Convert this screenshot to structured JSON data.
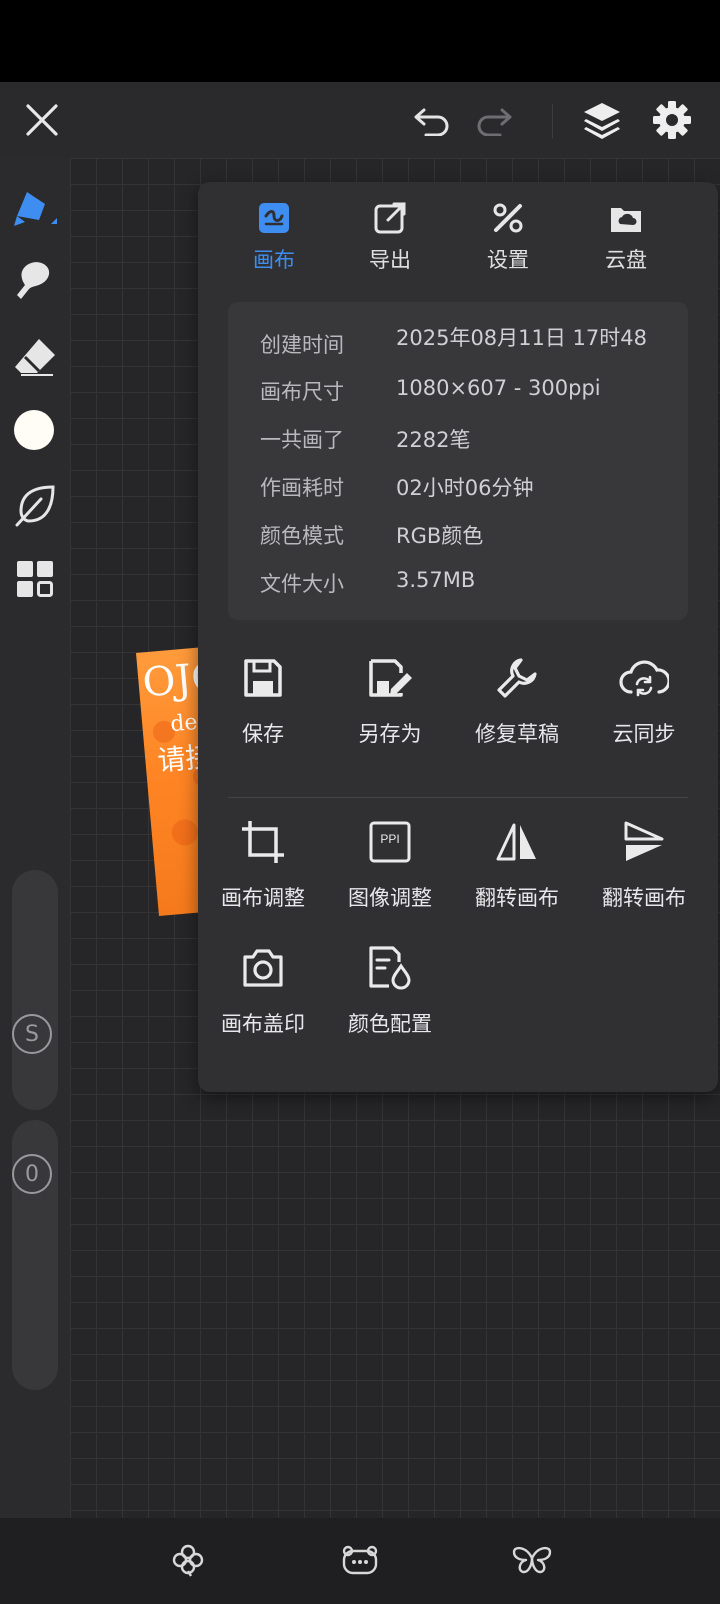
{
  "toolbar": {
    "close": "close-icon",
    "undo": "undo-icon",
    "redo": "redo-icon",
    "layers": "layers-icon",
    "settings": "gear-icon"
  },
  "tools": [
    "pen-brush-icon",
    "smudge-icon",
    "eraser-icon",
    "color-swatch",
    "leaf-icon",
    "grid-menu-icon"
  ],
  "sliders": {
    "size_label": "S",
    "opacity_label": "0"
  },
  "panel": {
    "tabs": [
      {
        "label": "画布",
        "icon": "canvas-icon",
        "active": true
      },
      {
        "label": "导出",
        "icon": "export-icon",
        "active": false
      },
      {
        "label": "设置",
        "icon": "tools-icon",
        "active": false
      },
      {
        "label": "云盘",
        "icon": "cloud-drive-icon",
        "active": false
      }
    ],
    "info": [
      {
        "key": "创建时间",
        "value": "2025年08月11日 17时48分"
      },
      {
        "key": "画布尺寸",
        "value": "1080×607 - 300ppi"
      },
      {
        "key": "一共画了",
        "value": "2282笔"
      },
      {
        "key": "作画耗时",
        "value": "02小时06分钟"
      },
      {
        "key": "颜色模式",
        "value": "RGB颜色"
      },
      {
        "key": "文件大小",
        "value": "3.57MB"
      }
    ],
    "actions_row1": [
      {
        "label": "保存",
        "icon": "save-icon"
      },
      {
        "label": "另存为",
        "icon": "save-as-icon"
      },
      {
        "label": "修复草稿",
        "icon": "wrench-icon"
      },
      {
        "label": "云同步",
        "icon": "cloud-sync-icon"
      }
    ],
    "actions_row2": [
      {
        "label": "画布调整",
        "icon": "crop-icon"
      },
      {
        "label": "图像调整",
        "icon": "ppi-icon",
        "badge": "PPI"
      },
      {
        "label": "翻转画布",
        "icon": "flip-horizontal-icon"
      },
      {
        "label": "翻转画布",
        "icon": "flip-vertical-icon"
      }
    ],
    "actions_row3": [
      {
        "label": "画布盖印",
        "icon": "camera-icon"
      },
      {
        "label": "颜色配置",
        "icon": "color-config-icon"
      }
    ]
  },
  "bottom": [
    "clover-icon",
    "bear-icon",
    "butterfly-icon"
  ],
  "artwork_text": {
    "top": "OJO",
    "mid": "de",
    "bottom": "请接"
  },
  "colors": {
    "accent": "#3d8ef0",
    "panel": "#303033",
    "artwork": "#ff8a2a"
  }
}
